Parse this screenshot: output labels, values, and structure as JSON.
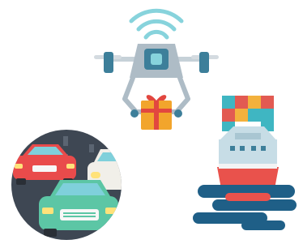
{
  "scene": {
    "illustrations": [
      {
        "id": "drone",
        "icon": "drone-delivery-icon",
        "parts": [
          "wifi-signal-icon",
          "gift-box-icon"
        ]
      },
      {
        "id": "traffic",
        "icon": "traffic-jam-icon",
        "parts": [
          "car-icon"
        ]
      },
      {
        "id": "ship",
        "icon": "container-ship-icon",
        "parts": [
          "water-waves-icon"
        ]
      }
    ],
    "colors": {
      "drone_body": "#aebcc6",
      "drone_motor": "#3d7f9a",
      "gift_box": "#f2a52c",
      "gift_ribbon": "#e2473f",
      "wifi": "#87d3dc",
      "traffic_bg": "#3e4753",
      "car_red": "#e94b4b",
      "car_green": "#5cc6a5",
      "ship_hull": "#e9524c",
      "ship_deck": "#c7dde6",
      "water": "#1f5f87",
      "container_teal": "#3fb6c2",
      "container_red": "#e25a52",
      "container_orange": "#f3b13d"
    }
  }
}
